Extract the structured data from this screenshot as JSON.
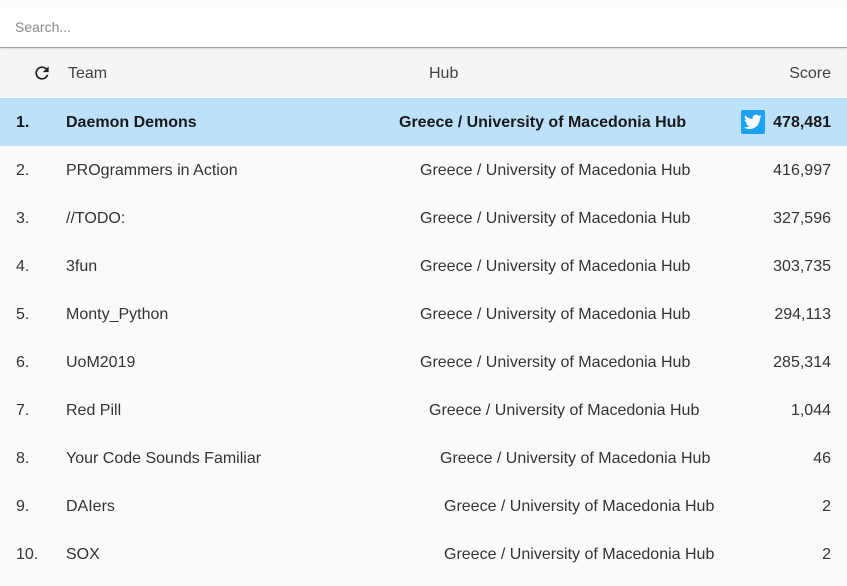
{
  "search": {
    "placeholder": "Search..."
  },
  "header": {
    "team": "Team",
    "hub": "Hub",
    "score": "Score"
  },
  "rows": [
    {
      "rank": "1.",
      "team": "Daemon Demons",
      "hub": "Greece / University of Macedonia Hub",
      "score": "478,481"
    },
    {
      "rank": "2.",
      "team": "PROgrammers in Action",
      "hub": "Greece / University of Macedonia Hub",
      "score": "416,997"
    },
    {
      "rank": "3.",
      "team": "//TODO:",
      "hub": "Greece / University of Macedonia Hub",
      "score": "327,596"
    },
    {
      "rank": "4.",
      "team": "3fun",
      "hub": "Greece / University of Macedonia Hub",
      "score": "303,735"
    },
    {
      "rank": "5.",
      "team": "Monty_Python",
      "hub": "Greece / University of Macedonia Hub",
      "score": "294,113"
    },
    {
      "rank": "6.",
      "team": "UoM2019",
      "hub": "Greece / University of Macedonia Hub",
      "score": "285,314"
    },
    {
      "rank": "7.",
      "team": "Red Pill",
      "hub": "Greece / University of Macedonia Hub",
      "score": "1,044"
    },
    {
      "rank": "8.",
      "team": "Your Code Sounds Familiar",
      "hub": "Greece / University of Macedonia Hub",
      "score": "46"
    },
    {
      "rank": "9.",
      "team": "DAIers",
      "hub": "Greece / University of Macedonia Hub",
      "score": "2"
    },
    {
      "rank": "10.",
      "team": "SOX",
      "hub": "Greece / University of Macedonia Hub",
      "score": "2"
    }
  ],
  "icons": {
    "refresh": "refresh-icon",
    "twitter": "twitter-icon"
  },
  "colors": {
    "highlight_row": "#bde0fb",
    "twitter": "#1da1f2"
  }
}
